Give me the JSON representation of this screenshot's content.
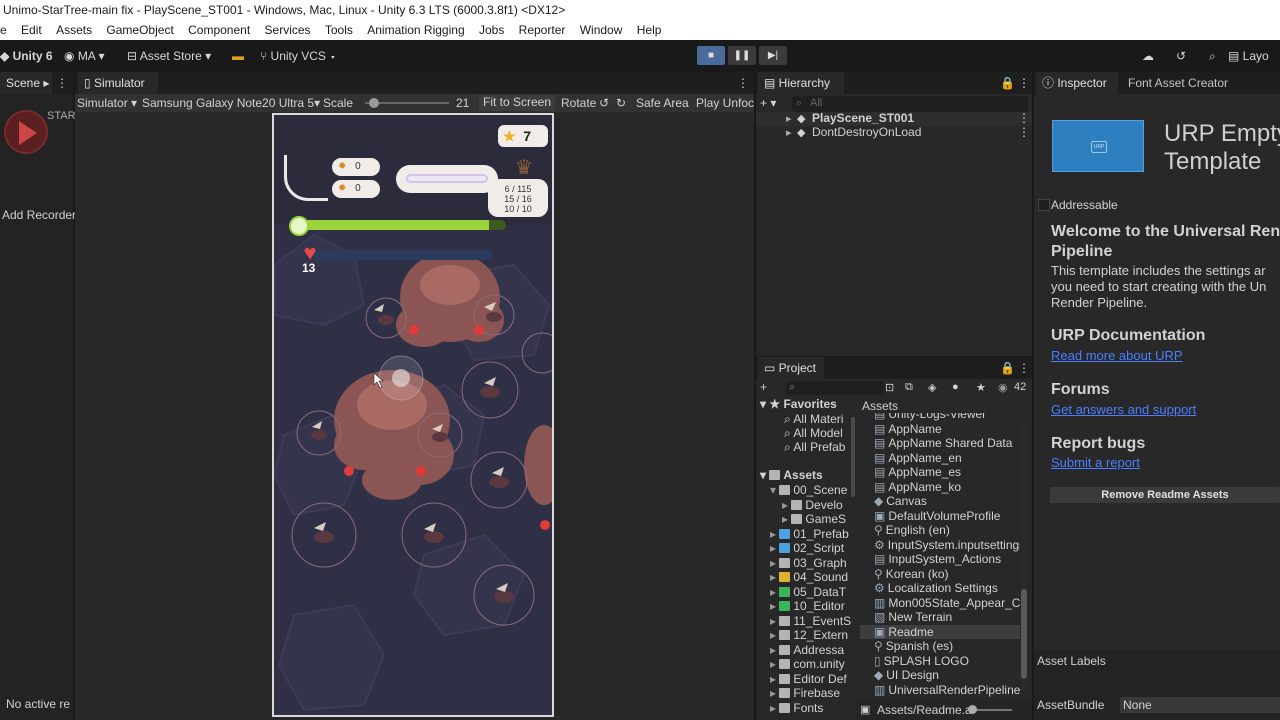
{
  "window": {
    "title": "Unimo-StarTree-main fix - PlayScene_ST001 - Windows, Mac, Linux - Unity 6.3 LTS (6000.3.8f1) <DX12>"
  },
  "menu": [
    "e",
    "Edit",
    "Assets",
    "GameObject",
    "Component",
    "Services",
    "Tools",
    "Animation Rigging",
    "Jobs",
    "Reporter",
    "Window",
    "Help"
  ],
  "toolbar": {
    "unity": "Unity 6",
    "account": "MA",
    "asset_store": "Asset Store",
    "vcs": "Unity VCS",
    "layout": "Layo"
  },
  "scene_panel": {
    "tab": "Scene",
    "start_label": "STAR",
    "add_recorder": "Add Recorder",
    "no_active": "No active re"
  },
  "simulator": {
    "tab": "Simulator",
    "mode": "Simulator",
    "device": "Samsung Galaxy Note20 Ultra 5",
    "scale_label": "Scale",
    "scale_value": "21",
    "fit": "Fit to Screen",
    "rotate": "Rotate",
    "safe_area": "Safe Area",
    "play_unfocused": "Play Unfoc"
  },
  "game": {
    "stars": "7",
    "res1": "0",
    "res2": "0",
    "stat1": "6 / 115",
    "stat2": "15 / 16",
    "stat3": "10 / 10",
    "hearts": "13",
    "progress_pct": 92
  },
  "hierarchy": {
    "tab": "Hierarchy",
    "search_placeholder": "All",
    "items": [
      "PlayScene_ST001",
      "DontDestroyOnLoad"
    ]
  },
  "project": {
    "tab": "Project",
    "count": "42",
    "favorites_label": "Favorites",
    "favorites": [
      "All Materi",
      "All Model",
      "All Prefab"
    ],
    "assets_label": "Assets",
    "tree": [
      {
        "label": "00_Scene",
        "depth": 1,
        "color": "#b4b4b4"
      },
      {
        "label": "Develo",
        "depth": 2,
        "color": "#b4b4b4"
      },
      {
        "label": "GameS",
        "depth": 2,
        "color": "#b4b4b4"
      },
      {
        "label": "01_Prefab",
        "depth": 1,
        "color": "#4aa3e0"
      },
      {
        "label": "02_Script",
        "depth": 1,
        "color": "#4aa3e0"
      },
      {
        "label": "03_Graph",
        "depth": 1,
        "color": "#b4b4b4"
      },
      {
        "label": "04_Sound",
        "depth": 1,
        "color": "#e0b030"
      },
      {
        "label": "05_DataT",
        "depth": 1,
        "color": "#3ab55a"
      },
      {
        "label": "10_Editor",
        "depth": 1,
        "color": "#3ab55a"
      },
      {
        "label": "11_EventS",
        "depth": 1,
        "color": "#b4b4b4"
      },
      {
        "label": "12_Extern",
        "depth": 1,
        "color": "#b4b4b4"
      },
      {
        "label": "Addressa",
        "depth": 1,
        "color": "#b4b4b4"
      },
      {
        "label": "com.unity",
        "depth": 1,
        "color": "#b4b4b4"
      },
      {
        "label": "Editor Def",
        "depth": 1,
        "color": "#b4b4b4"
      },
      {
        "label": "Firebase",
        "depth": 1,
        "color": "#b4b4b4"
      },
      {
        "label": "Fonts",
        "depth": 1,
        "color": "#b4b4b4"
      }
    ],
    "breadcrumb": "Assets",
    "list": [
      "Unity-Logs-Viewer",
      "AppName",
      "AppName Shared Data",
      "AppName_en",
      "AppName_es",
      "AppName_ko",
      "Canvas",
      "DefaultVolumeProfile",
      "English (en)",
      "InputSystem.inputsettings",
      "InputSystem_Actions",
      "Korean (ko)",
      "Localization Settings",
      "Mon005State_Appear_C",
      "New Terrain",
      "Readme",
      "Spanish (es)",
      "SPLASH LOGO",
      "UI Design",
      "UniversalRenderPipelineG"
    ],
    "selected": "Readme",
    "footer_path": "Assets/Readme.a"
  },
  "inspector": {
    "tab": "Inspector",
    "tab2": "Font Asset Creator",
    "title_line1": "URP Empty",
    "title_line2": "Template",
    "addressable": "Addressable",
    "welcome_line1": "Welcome to the Universal Ren",
    "welcome_line2": "Pipeline",
    "body_line1": "This template includes the settings ar",
    "body_line2": "you need to start creating with the Un",
    "body_line3": "Render Pipeline.",
    "doc_heading": "URP Documentation",
    "doc_link": "Read more about URP",
    "forums_heading": "Forums",
    "forums_link": "Get answers and support",
    "bugs_heading": "Report bugs",
    "bugs_link": "Submit a report",
    "remove_button": "Remove Readme Assets",
    "asset_labels": "Asset Labels",
    "asset_bundle": "AssetBundle",
    "asset_bundle_value": "None"
  }
}
